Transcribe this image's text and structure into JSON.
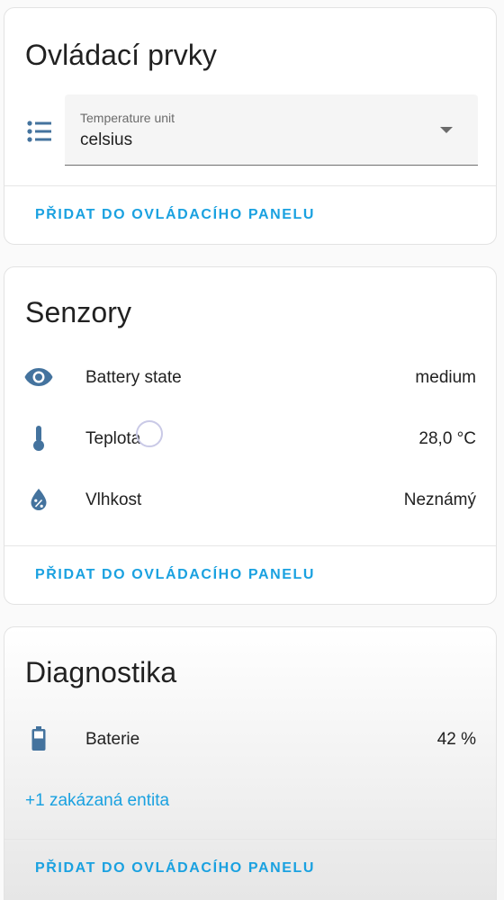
{
  "colors": {
    "accent": "#1aa1e0",
    "icon": "#44739e"
  },
  "controls": {
    "title": "Ovládací prvky",
    "icon": "format-list-bulleted-icon",
    "select": {
      "label": "Temperature unit",
      "value": "celsius"
    },
    "action_label": "PŘIDAT DO OVLÁDACÍHO PANELU"
  },
  "sensors": {
    "title": "Senzory",
    "items": [
      {
        "icon": "eye-icon",
        "name": "Battery state",
        "value": "medium"
      },
      {
        "icon": "thermometer-icon",
        "name": "Teplota",
        "value": "28,0 °C"
      },
      {
        "icon": "water-percent-icon",
        "name": "Vlhkost",
        "value": "Neznámý"
      }
    ],
    "action_label": "PŘIDAT DO OVLÁDACÍHO PANELU"
  },
  "diagnostics": {
    "title": "Diagnostika",
    "items": [
      {
        "icon": "battery-icon",
        "name": "Baterie",
        "value": "42 %"
      }
    ],
    "disabled_entities_label": "+1 zakázaná entita",
    "action_label": "PŘIDAT DO OVLÁDACÍHO PANELU"
  }
}
